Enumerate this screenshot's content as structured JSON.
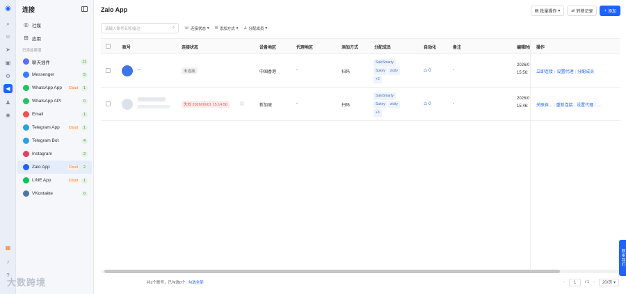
{
  "sidebar": {
    "title": "连接",
    "top_items": [
      {
        "label": "社媒"
      },
      {
        "label": "应用"
      }
    ],
    "section_label": "已添加渠道",
    "items": [
      {
        "label": "聊天插件",
        "count": "11",
        "color": "#5b6cff",
        "cloud": ""
      },
      {
        "label": "Messenger",
        "count": "5",
        "color": "#3b7bf7",
        "cloud": ""
      },
      {
        "label": "WhatsApp App",
        "count": "1",
        "color": "#25c163",
        "cloud": "Cloud"
      },
      {
        "label": "WhatsApp API",
        "count": "0",
        "color": "#25c163",
        "cloud": ""
      },
      {
        "label": "Email",
        "count": "1",
        "color": "#f05050",
        "cloud": ""
      },
      {
        "label": "Telegram App",
        "count": "1",
        "color": "#2aa1e3",
        "cloud": "Cloud"
      },
      {
        "label": "Telegram Bot",
        "count": "4",
        "color": "#2aa1e3",
        "cloud": ""
      },
      {
        "label": "Instagram",
        "count": "2",
        "color": "#e4405f",
        "cloud": ""
      },
      {
        "label": "Zalo App",
        "count": "2",
        "color": "#1e63ff",
        "cloud": "Cloud"
      },
      {
        "label": "LINE App",
        "count": "1",
        "color": "#06c755",
        "cloud": "Cloud"
      },
      {
        "label": "VKontakte",
        "count": "0",
        "color": "#4a76a8",
        "cloud": ""
      }
    ]
  },
  "page": {
    "title": "Zalo App",
    "batch_button": "批量操作",
    "transfer_button": "转移记录",
    "add_button": "添加"
  },
  "filters": {
    "search_placeholder": "请输入账号名称/备注",
    "conn_status": "连接状态",
    "add_method": "添加方式",
    "assigned_members": "分配成员"
  },
  "table": {
    "headers": {
      "account": "账号",
      "conn_status": "连接状态",
      "device_region": "设备地区",
      "proxy_region": "代理地区",
      "add_method": "添加方式",
      "assigned": "分配成员",
      "auto": "自动化",
      "remark": "备注",
      "edit_time": "编辑时间",
      "ops": "操作"
    },
    "rows": [
      {
        "account_name": "--",
        "status": "未连接",
        "device_region": "中国香港",
        "proxy_region": "-",
        "add_method": "扫码",
        "members": [
          "SaleSmarty",
          "Sukey",
          "zicity",
          "+3"
        ],
        "auto": "0",
        "remark": "-",
        "time_line1": "2026/0",
        "time_line2": "15:56:",
        "ops": [
          "立即连接",
          "设置代理",
          "分配成员"
        ]
      },
      {
        "account_name": "",
        "status": "失效 2026/06/01 15:14:56",
        "device_region": "新加坡",
        "proxy_region": "-",
        "add_method": "扫码",
        "members": [
          "SaleSmarty",
          "Sukey",
          "zicity",
          "+3"
        ],
        "auto": "0",
        "remark": "-",
        "time_line1": "2026/0",
        "time_line2": "15:46:",
        "ops": [
          "关联自...",
          "重新连接",
          "设置代理",
          "..."
        ]
      }
    ]
  },
  "footer": {
    "summary": "共2个账号，已勾选0个",
    "select_all": "勾选全部",
    "page_current": "1",
    "page_total": "/ 1",
    "page_size": "20/页"
  },
  "fab_label": "联系我们",
  "watermark": "大数跨境",
  "colors": {
    "accent": "#1e63ff",
    "danger": "#f56c6c"
  }
}
